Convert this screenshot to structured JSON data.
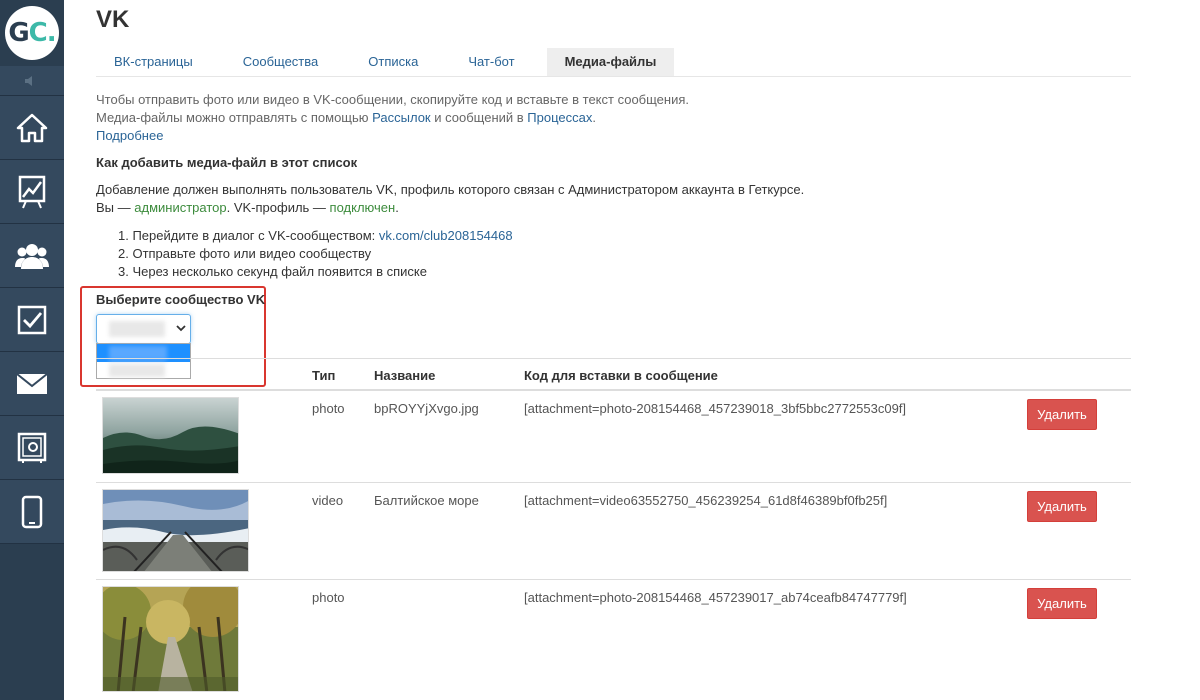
{
  "logo": {
    "text_g": "G",
    "text_c": "C",
    "text_dot": "."
  },
  "sidebar": {
    "items": [
      {
        "icon": "home-icon"
      },
      {
        "icon": "chart-icon"
      },
      {
        "icon": "users-icon"
      },
      {
        "icon": "tasks-icon"
      },
      {
        "icon": "mail-icon"
      },
      {
        "icon": "safe-icon"
      },
      {
        "icon": "mobile-icon"
      }
    ]
  },
  "page": {
    "title": "VK"
  },
  "tabs": [
    {
      "label": "ВК-страницы",
      "active": false
    },
    {
      "label": "Сообщества",
      "active": false
    },
    {
      "label": "Отписка",
      "active": false
    },
    {
      "label": "Чат-бот",
      "active": false
    },
    {
      "label": "Медиа-файлы",
      "active": true
    }
  ],
  "intro": {
    "line1": "Чтобы отправить фото или видео в VK-сообщении, скопируйте код и вставьте в текст сообщения.",
    "line2_before": "Медиа-файлы можно отправлять с помощью ",
    "line2_link1": "Рассылок",
    "line2_mid": " и сообщений в ",
    "line2_link2": "Процессах",
    "line2_after": ".",
    "more_link": "Подробнее"
  },
  "howto": {
    "heading": "Как добавить медиа-файл в этот список",
    "desc1": "Добавление должен выполнять пользователь VK, профиль которого связан с Администратором аккаунта в Геткурсе.",
    "desc2_before": "Вы — ",
    "desc2_role": "администратор",
    "desc2_mid": ". VK-профиль — ",
    "desc2_status": "подключен",
    "desc2_after": ".",
    "step1_before": "1. Перейдите в диалог с VK-сообществом: ",
    "step1_link": "vk.com/club208154468",
    "step2": "2. Отправьте фото или видео сообществу",
    "step3": "3. Через несколько секунд файл появится в списке"
  },
  "community_select": {
    "label": "Выберите сообщество VK"
  },
  "table": {
    "headers": {
      "type": "Тип",
      "name": "Название",
      "code": "Код для вставки в сообщение"
    },
    "rows": [
      {
        "type": "photo",
        "name": "bpROYYjXvgo.jpg",
        "code": "[attachment=photo-208154468_457239018_3bf5bbc2772553c09f]",
        "delete": "Удалить",
        "thumb": "forest-fog"
      },
      {
        "type": "video",
        "name": "Балтийское море",
        "code": "[attachment=video63552750_456239254_61d8f46389bf0fb25f]",
        "delete": "Удалить",
        "thumb": "sea-stairs"
      },
      {
        "type": "photo",
        "name": "",
        "code": "[attachment=photo-208154468_457239017_ab74ceafb84747779f]",
        "delete": "Удалить",
        "thumb": "autumn-alley"
      }
    ]
  },
  "colors": {
    "sidebar": "#2b3e50",
    "accent": "#3db9a8",
    "link": "#2a6496",
    "danger": "#d9534f",
    "highlight": "#d9362f"
  }
}
